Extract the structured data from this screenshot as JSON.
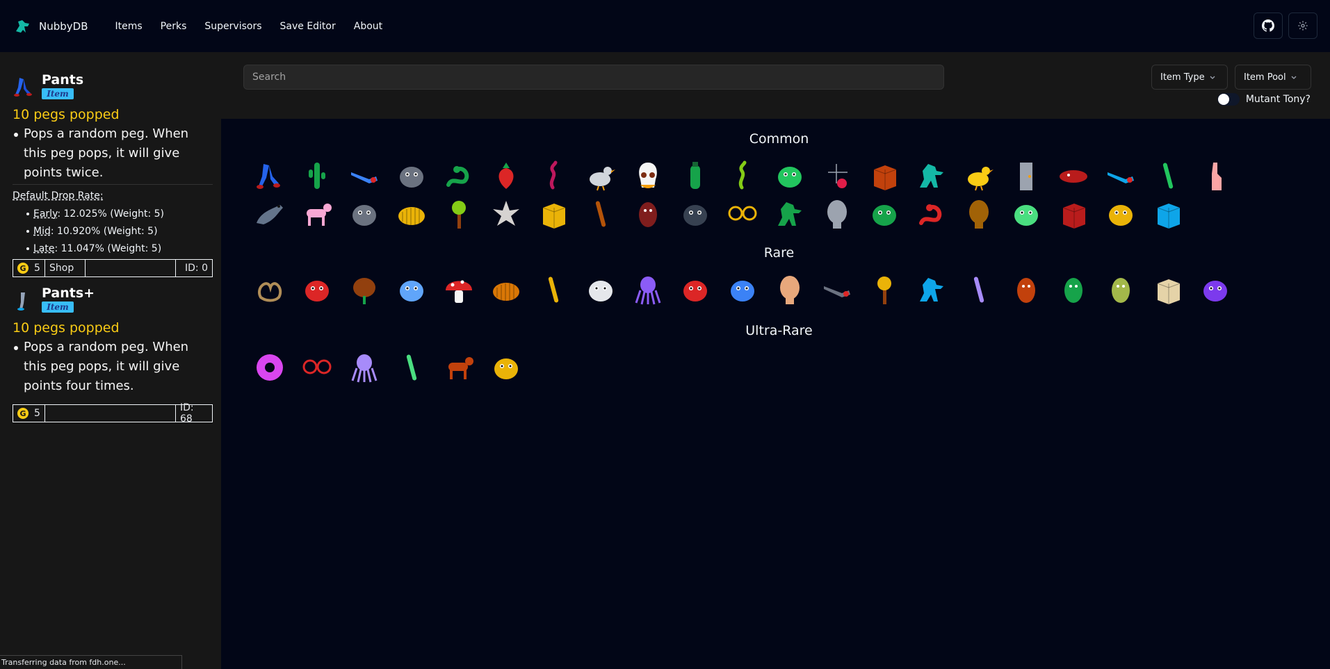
{
  "nav": {
    "brand": "NubbyDB",
    "links": [
      "Items",
      "Perks",
      "Supervisors",
      "Save Editor",
      "About"
    ],
    "github_icon": "github-icon",
    "settings_icon": "gear-icon"
  },
  "sidebar": {
    "cards": [
      {
        "name": "Pants",
        "badge": "Item",
        "trigger": "10 pegs popped",
        "desc": "Pops a random peg. When this peg pops, it will give points twice.",
        "drop_title": "Default Drop Rate:",
        "drops": [
          {
            "stage": "Early",
            "rate": ": 12.025% (Weight: 5)"
          },
          {
            "stage": "Mid",
            "rate": ": 10.920% (Weight: 5)"
          },
          {
            "stage": "Late",
            "rate": ": 11.047% (Weight: 5)"
          }
        ],
        "coin_glyph": "G",
        "price": "5",
        "pool": "Shop",
        "id": "ID: 0"
      },
      {
        "name": "Pants+",
        "badge": "Item",
        "trigger": "10 pegs popped",
        "desc": "Pops a random peg. When this peg pops, it will give points four times.",
        "coin_glyph": "G",
        "price": "5",
        "pool": "",
        "id": "ID: 68"
      }
    ]
  },
  "filters": {
    "search_placeholder": "Search",
    "item_type": "Item Type",
    "item_pool": "Item Pool",
    "toggle_label": "Mutant Tony?"
  },
  "sections": {
    "common": "Common",
    "rare": "Rare",
    "ultra": "Ultra-Rare"
  },
  "status": "Transferring data from fdh.one...",
  "colors": {
    "bg": "#020617",
    "panel": "#171717",
    "trigger": "#facc15",
    "badge": "#38bdf8"
  },
  "items": {
    "common": [
      {
        "c": "#2563eb",
        "s": "legs"
      },
      {
        "c": "#16a34a",
        "s": "cactus"
      },
      {
        "c": "#3b82f6",
        "s": "tool"
      },
      {
        "c": "#6b7280",
        "s": "blob"
      },
      {
        "c": "#16a34a",
        "s": "snake"
      },
      {
        "c": "#dc2626",
        "s": "berry"
      },
      {
        "c": "#be185d",
        "s": "worm"
      },
      {
        "c": "#d1d5db",
        "s": "bird"
      },
      {
        "c": "#f5f5f4",
        "s": "skull"
      },
      {
        "c": "#16a34a",
        "s": "bottle"
      },
      {
        "c": "#84cc16",
        "s": "worm"
      },
      {
        "c": "#22c55e",
        "s": "blob"
      },
      {
        "c": "#9ca3af",
        "s": "dots"
      },
      {
        "c": "#c2410c",
        "s": "box"
      },
      {
        "c": "#14b8a6",
        "s": "dino"
      },
      {
        "c": "#facc15",
        "s": "bird"
      },
      {
        "c": "#9ca3af",
        "s": "door"
      },
      {
        "c": "#b91c1c",
        "s": "sausage"
      },
      {
        "c": "#0ea5e9",
        "s": "tool"
      },
      {
        "c": "#22c55e",
        "s": "stick"
      },
      {
        "c": "#fca5a5",
        "s": "finger"
      },
      {
        "c": "#64748b",
        "s": "seal"
      },
      {
        "c": "#f9a8d4",
        "s": "dog"
      },
      {
        "c": "#6b7280",
        "s": "blob"
      },
      {
        "c": "#eab308",
        "s": "grub"
      },
      {
        "c": "#84cc16",
        "s": "tree"
      },
      {
        "c": "#d6d3d1",
        "s": "spike"
      },
      {
        "c": "#eab308",
        "s": "box"
      },
      {
        "c": "#b45309",
        "s": "stick"
      },
      {
        "c": "#7f1d1d",
        "s": "bean"
      },
      {
        "c": "#374151",
        "s": "blob"
      },
      {
        "c": "#eab308",
        "s": "glasses"
      },
      {
        "c": "#16a34a",
        "s": "dino"
      },
      {
        "c": "#9ca3af",
        "s": "head"
      },
      {
        "c": "#16a34a",
        "s": "blob"
      },
      {
        "c": "#dc2626",
        "s": "snake"
      },
      {
        "c": "#a16207",
        "s": "head"
      },
      {
        "c": "#4ade80",
        "s": "blob"
      },
      {
        "c": "#b91c1c",
        "s": "box"
      },
      {
        "c": "#eab308",
        "s": "blob"
      },
      {
        "c": "#0ea5e9",
        "s": "box"
      }
    ],
    "rare": [
      {
        "c": "#b08d57",
        "s": "pretzel"
      },
      {
        "c": "#dc2626",
        "s": "blob"
      },
      {
        "c": "#92400e",
        "s": "nut"
      },
      {
        "c": "#60a5fa",
        "s": "blob"
      },
      {
        "c": "#dc2626",
        "s": "mushroom"
      },
      {
        "c": "#d97706",
        "s": "grub"
      },
      {
        "c": "#eab308",
        "s": "stick"
      },
      {
        "c": "#e5e7eb",
        "s": "blob"
      },
      {
        "c": "#8b5cf6",
        "s": "squid"
      },
      {
        "c": "#dc2626",
        "s": "blob"
      },
      {
        "c": "#3b82f6",
        "s": "blob"
      },
      {
        "c": "#e8a87c",
        "s": "head"
      },
      {
        "c": "#6b7280",
        "s": "tool"
      },
      {
        "c": "#eab308",
        "s": "tree"
      },
      {
        "c": "#0ea5e9",
        "s": "dino"
      },
      {
        "c": "#a78bfa",
        "s": "stick"
      },
      {
        "c": "#c2410c",
        "s": "bean"
      },
      {
        "c": "#16a34a",
        "s": "bean"
      },
      {
        "c": "#a3b84a",
        "s": "bean"
      },
      {
        "c": "#e5d3a8",
        "s": "box"
      },
      {
        "c": "#7c3aed",
        "s": "blob"
      }
    ],
    "ultra": [
      {
        "c": "#d946ef",
        "s": "donut"
      },
      {
        "c": "#dc2626",
        "s": "glasses"
      },
      {
        "c": "#a78bfa",
        "s": "squid"
      },
      {
        "c": "#4ade80",
        "s": "stick"
      },
      {
        "c": "#c2410c",
        "s": "dog"
      },
      {
        "c": "#eab308",
        "s": "blob"
      }
    ]
  }
}
